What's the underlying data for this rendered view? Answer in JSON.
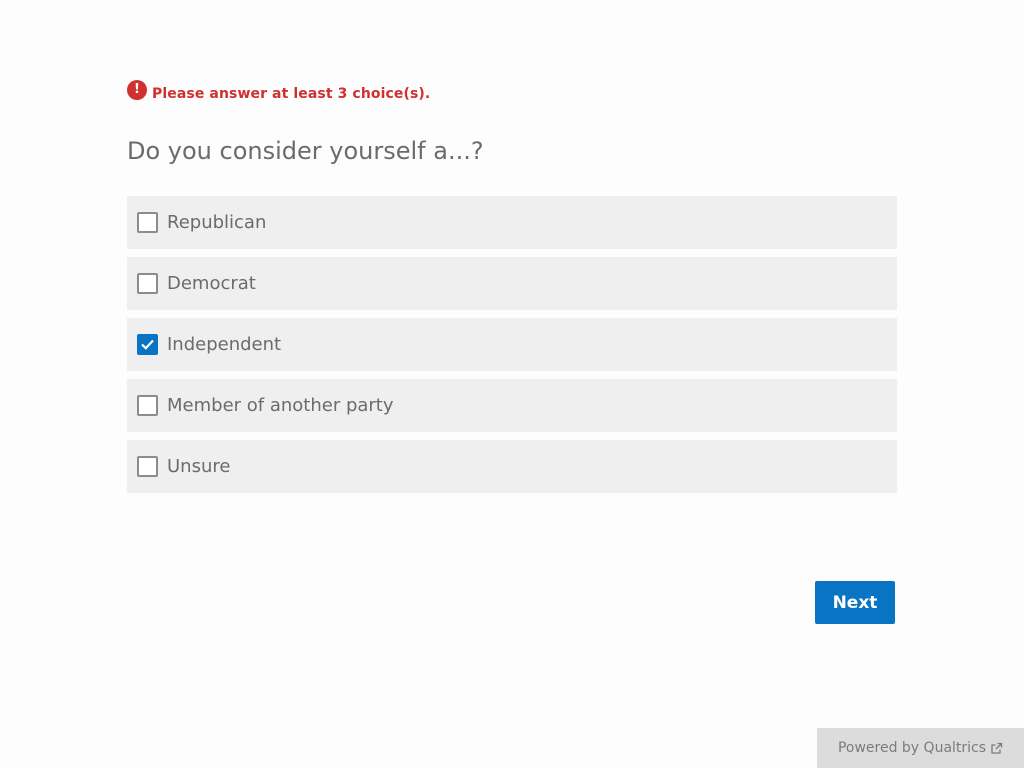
{
  "error": {
    "icon": "exclamation-icon",
    "icon_glyph": "!",
    "message": "Please answer at least 3 choice(s)."
  },
  "question": {
    "text": "Do you consider yourself a...?"
  },
  "choices": [
    {
      "label": "Republican",
      "checked": false
    },
    {
      "label": "Democrat",
      "checked": false
    },
    {
      "label": "Independent",
      "checked": true
    },
    {
      "label": "Member of another party",
      "checked": false
    },
    {
      "label": "Unsure",
      "checked": false
    }
  ],
  "navigation": {
    "next_label": "Next"
  },
  "footer": {
    "text": "Powered by Qualtrics",
    "icon": "external-link-icon"
  },
  "colors": {
    "accent": "#0a74c4",
    "error": "#d0302f",
    "choice_bg": "#efefef",
    "text": "#6b6b6b"
  }
}
